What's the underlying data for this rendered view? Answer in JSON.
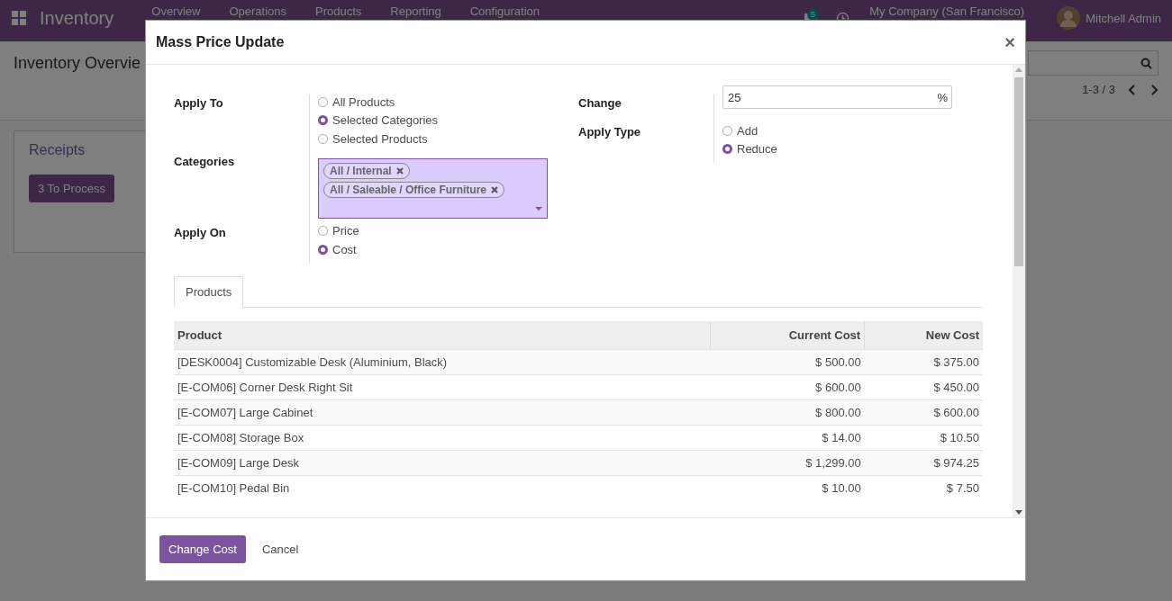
{
  "navbar": {
    "app_title": "Inventory",
    "menu": [
      "Overview",
      "Operations",
      "Products",
      "Reporting",
      "Configuration"
    ],
    "messages_badge": "5",
    "company": "My Company (San Francisco)",
    "user": "Mitchell Admin"
  },
  "control_panel": {
    "breadcrumb": "Inventory Overvie",
    "pager": "1-3 / 3"
  },
  "card": {
    "title": "Receipts",
    "button": "3 To Process"
  },
  "dialog": {
    "title": "Mass Price Update",
    "close": "×",
    "left_fields": [
      {
        "label": "Apply To",
        "kind": "radio",
        "options": [
          {
            "label": "All Products",
            "selected": false
          },
          {
            "label": "Selected Categories",
            "selected": true
          },
          {
            "label": "Selected Products",
            "selected": false
          }
        ]
      },
      {
        "label": "Categories",
        "kind": "tags",
        "tags": [
          "All / Internal",
          "All / Saleable / Office Furniture"
        ]
      },
      {
        "label": "Apply On",
        "kind": "radio",
        "options": [
          {
            "label": "Price",
            "selected": false
          },
          {
            "label": "Cost",
            "selected": true
          }
        ]
      }
    ],
    "right_fields": [
      {
        "label": "Change",
        "kind": "input",
        "value": "25",
        "suffix": "%"
      },
      {
        "label": "Apply Type",
        "kind": "radio",
        "options": [
          {
            "label": "Add",
            "selected": false
          },
          {
            "label": "Reduce",
            "selected": true
          }
        ]
      }
    ],
    "tabs": [
      {
        "label": "Products",
        "selected": true
      }
    ],
    "table": {
      "columns": [
        "Product",
        "Current Cost",
        "New Cost"
      ],
      "rows": [
        [
          "[DESK0004] Customizable Desk (Aluminium, Black)",
          "$ 500.00",
          "$ 375.00"
        ],
        [
          "[E-COM06] Corner Desk Right Sit",
          "$ 600.00",
          "$ 450.00"
        ],
        [
          "[E-COM07] Large Cabinet",
          "$ 800.00",
          "$ 600.00"
        ],
        [
          "[E-COM08] Storage Box",
          "$ 14.00",
          "$ 10.50"
        ],
        [
          "[E-COM09] Large Desk",
          "$ 1,299.00",
          "$ 974.25"
        ],
        [
          "[E-COM10] Pedal Bin",
          "$ 10.00",
          "$ 7.50"
        ]
      ]
    },
    "buttons": [
      {
        "label": "Change Cost",
        "kind": "primary"
      },
      {
        "label": "Cancel",
        "kind": "link"
      }
    ]
  }
}
